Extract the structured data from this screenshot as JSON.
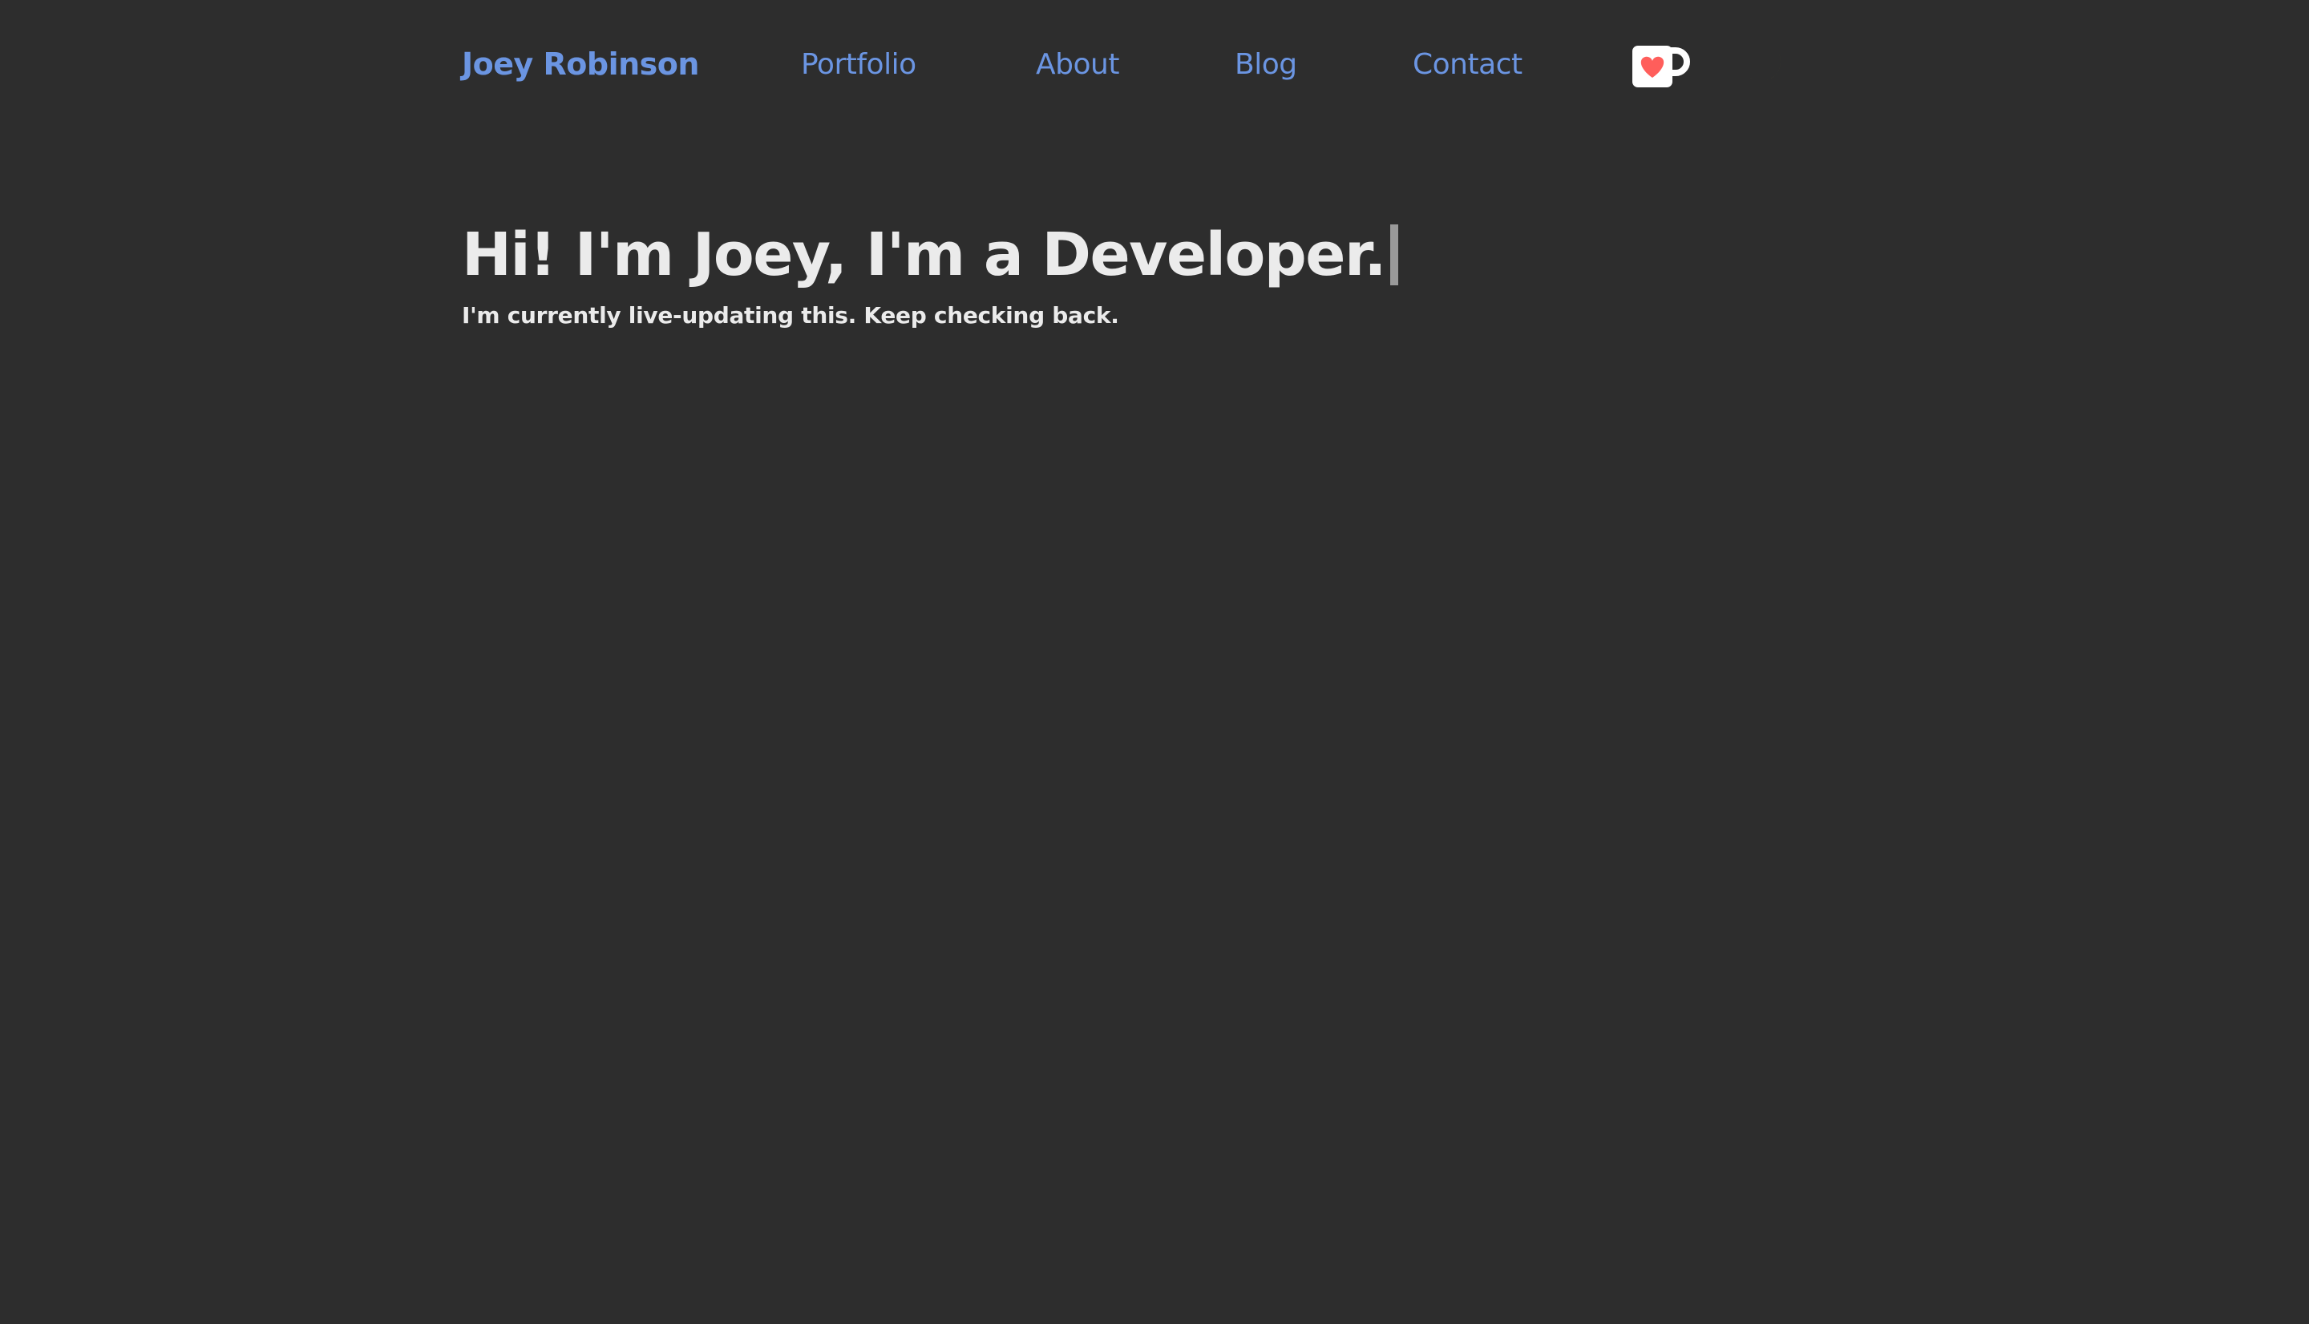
{
  "header": {
    "brand": "Joey Robinson",
    "nav": {
      "portfolio": "Portfolio",
      "about": "About",
      "blog": "Blog",
      "contact": "Contact"
    },
    "icons": {
      "support": "ko-fi-cup-icon",
      "theme_toggle": "moon-icon"
    }
  },
  "hero": {
    "headline": "Hi! I'm Joey, I'm a Developer.",
    "subtitle": "I'm currently live-updating this. Keep checking back."
  },
  "colors": {
    "background": "#2d2d2d",
    "link": "#6b95e2",
    "text": "#ebebeb",
    "cursor": "#9a9a9a",
    "heart": "#ff5e5b",
    "moon": "#f8c53a"
  }
}
